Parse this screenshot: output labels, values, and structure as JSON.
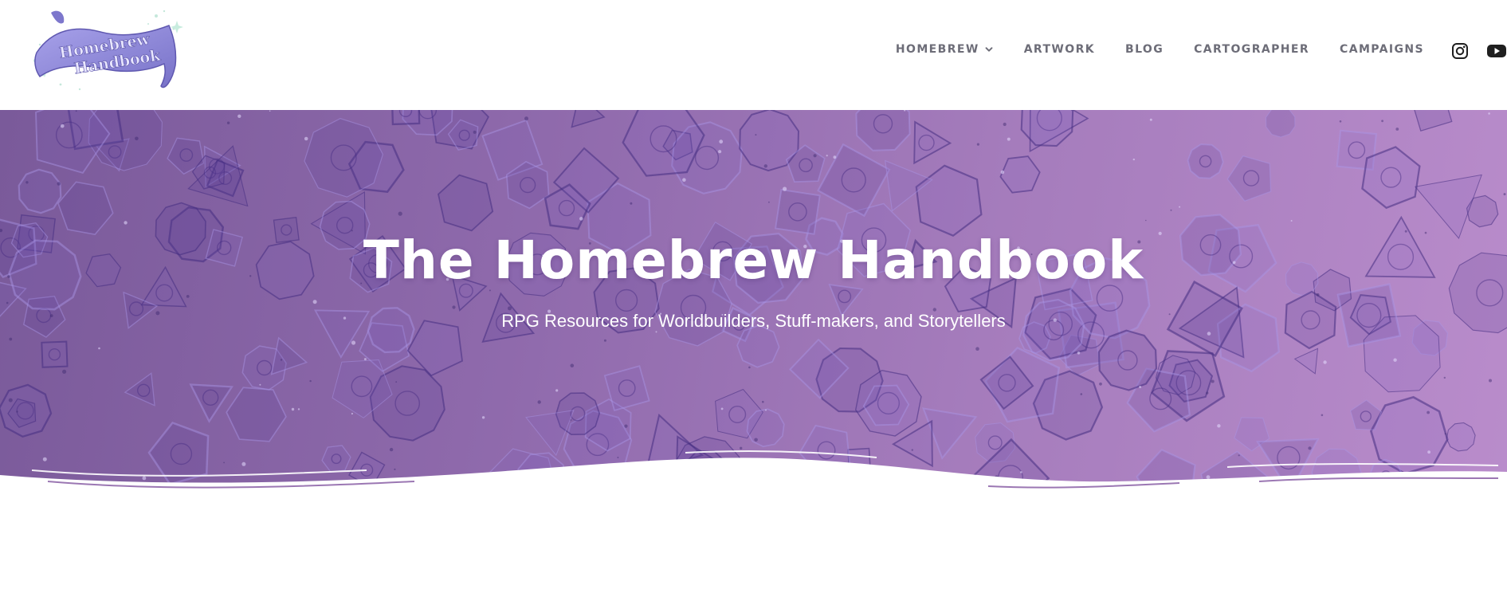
{
  "header": {
    "logo": {
      "text_line1": "Homebrew",
      "text_line2": "Handbook"
    },
    "nav": [
      {
        "label": "HOMEBREW",
        "has_dropdown": true
      },
      {
        "label": "ARTWORK"
      },
      {
        "label": "BLOG"
      },
      {
        "label": "CARTOGRAPHER"
      },
      {
        "label": "CAMPAIGNS"
      }
    ],
    "social": [
      {
        "icon": "instagram-icon"
      },
      {
        "icon": "youtube-icon"
      }
    ]
  },
  "hero": {
    "title": "The Homebrew Handbook",
    "subtitle": "RPG Resources for Worldbuilders, Stuff-makers, and Storytellers"
  },
  "colors": {
    "nav_text": "#6d6d78",
    "hero_start": "#7a5a9a",
    "hero_end": "#b98ccb",
    "logo_banner": "#8d86d8",
    "hero_text": "#ffffff"
  }
}
